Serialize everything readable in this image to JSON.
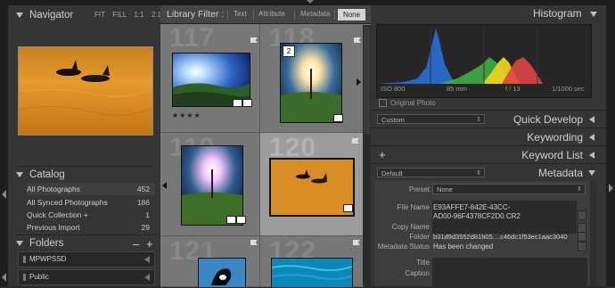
{
  "navigator": {
    "title": "Navigator",
    "zoom": [
      "FIT",
      "FILL",
      "1:1",
      "2:1"
    ]
  },
  "catalog": {
    "title": "Catalog",
    "items": [
      {
        "label": "All Photographs",
        "count": "452"
      },
      {
        "label": "All Synced Photographs",
        "count": "186"
      },
      {
        "label": "Quick Collection +",
        "count": "1"
      },
      {
        "label": "Previous Import",
        "count": "29"
      }
    ]
  },
  "folders": {
    "title": "Folders",
    "minus": "–",
    "plus": "+",
    "items": [
      {
        "label": "MPWPSSD"
      },
      {
        "label": "Public"
      }
    ]
  },
  "filter": {
    "label": "Library Filter :",
    "tabs": [
      "Text",
      "Attribute",
      "Metadata",
      "None"
    ]
  },
  "grid": {
    "cells": [
      {
        "num": "117",
        "rating": "★★★★"
      },
      {
        "num": "118",
        "badge": "2"
      },
      {
        "num": "119"
      },
      {
        "num": "120"
      },
      {
        "num": "121"
      },
      {
        "num": "122"
      }
    ]
  },
  "histogram": {
    "title": "Histogram",
    "iso": "ISO 800",
    "focal": "85 mm",
    "aperture": "f / 13",
    "shutter": "1/1000 sec",
    "original_photo": "Original Photo"
  },
  "quick_develop": {
    "title": "Quick Develop",
    "preset": "Custom"
  },
  "keywording": {
    "title": "Keywording"
  },
  "keyword_list": {
    "title": "Keyword List",
    "plus": "+"
  },
  "metadata": {
    "title": "Metadata",
    "preset_dropdown": "Default",
    "preset_label": "Preset",
    "preset_value": "None",
    "file_name_label": "File Name",
    "file_name_value_1": "E93AFFE7-842E-43CC-",
    "file_name_value_2": "AD00-96F4378CF2D0.CR2",
    "copy_name_label": "Copy Name",
    "folder_label": "Folder",
    "folder_value": "b31d9d3552d81b05....c46dc1f53ec1aac3040",
    "status_label": "Metadata Status",
    "status_value": "Has been changed",
    "title_label": "Title",
    "caption_label": "Caption"
  },
  "colors": {
    "panel_bg": "#353535",
    "grid_bg": "#7e7e7e",
    "hist_blue": "#2a6fd6",
    "hist_green": "#3fae3f",
    "hist_yellow": "#e9d21e",
    "hist_red": "#e04545"
  }
}
